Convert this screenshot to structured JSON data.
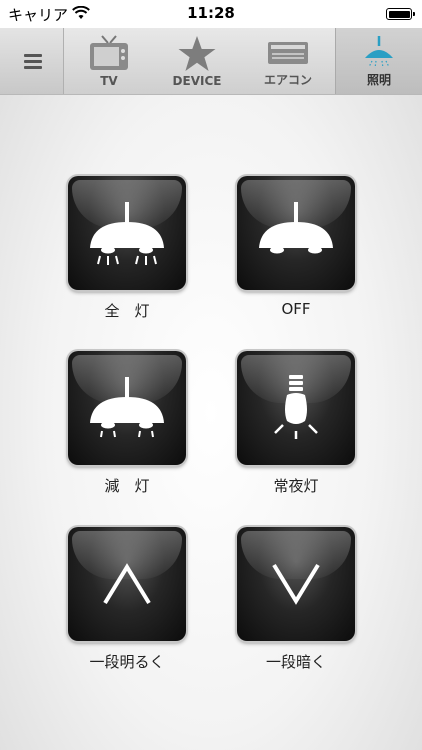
{
  "status_bar": {
    "carrier": "キャリア",
    "time": "11:28"
  },
  "menu": {
    "icon": "hamburger-menu-icon"
  },
  "tabs": [
    {
      "label": "TV",
      "icon": "tv-icon",
      "active": false
    },
    {
      "label": "DEVICE",
      "icon": "star-icon",
      "active": false
    },
    {
      "label": "エアコン",
      "icon": "air-conditioner-icon",
      "active": false
    },
    {
      "label": "照明",
      "icon": "ceiling-light-icon",
      "active": true
    }
  ],
  "accent_color": "#2a9fc4",
  "buttons": [
    {
      "label": "全　灯",
      "icon": "full-light-icon"
    },
    {
      "label": "OFF",
      "icon": "light-off-icon"
    },
    {
      "label": "減　灯",
      "icon": "dim-light-icon"
    },
    {
      "label": "常夜灯",
      "icon": "night-light-bulb-icon"
    },
    {
      "label": "一段明るく",
      "icon": "chevron-up-icon"
    },
    {
      "label": "一段暗く",
      "icon": "chevron-down-icon"
    }
  ]
}
